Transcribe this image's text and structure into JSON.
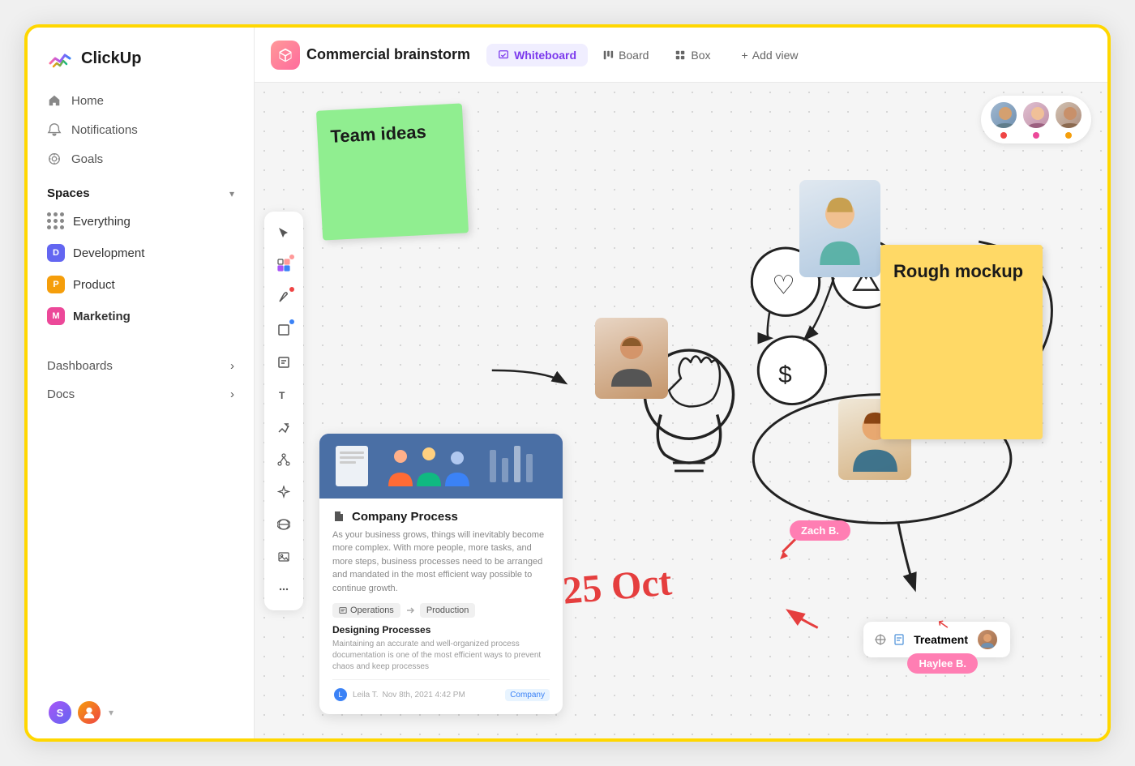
{
  "logo": {
    "text": "ClickUp"
  },
  "sidebar": {
    "nav_items": [
      {
        "id": "home",
        "label": "Home",
        "icon": "🏠"
      },
      {
        "id": "notifications",
        "label": "Notifications",
        "icon": "🔔"
      },
      {
        "id": "goals",
        "label": "Goals",
        "icon": "🏆"
      }
    ],
    "spaces_section": "Spaces",
    "spaces": [
      {
        "id": "everything",
        "label": "Everything",
        "color": "",
        "type": "grid"
      },
      {
        "id": "development",
        "label": "Development",
        "color": "#6366f1",
        "initial": "D"
      },
      {
        "id": "product",
        "label": "Product",
        "color": "#f59e0b",
        "initial": "P"
      },
      {
        "id": "marketing",
        "label": "Marketing",
        "color": "#ec4899",
        "initial": "M",
        "active": true
      }
    ],
    "bottom_items": [
      {
        "id": "dashboards",
        "label": "Dashboards"
      },
      {
        "id": "docs",
        "label": "Docs"
      }
    ]
  },
  "header": {
    "project_title": "Commercial brainstorm",
    "tabs": [
      {
        "id": "whiteboard",
        "label": "Whiteboard",
        "active": true
      },
      {
        "id": "board",
        "label": "Board",
        "active": false
      },
      {
        "id": "box",
        "label": "Box",
        "active": false
      }
    ],
    "add_view_label": "Add view"
  },
  "canvas": {
    "sticky_green_text": "Team ideas",
    "sticky_yellow_text": "Rough mockup",
    "doc_title": "Company Process",
    "doc_desc": "As your business grows, things will inevitably become more complex. With more people, more tasks, and more steps, business processes need to be arranged and mandated in the most efficient way possible to continue growth.",
    "doc_tags": [
      "Operations",
      "Production"
    ],
    "doc_section_title": "Designing Processes",
    "doc_section_desc": "Maintaining an accurate and well-organized process documentation is one of the most efficient ways to prevent chaos and keep processes",
    "doc_author": "Leila T.",
    "doc_date": "Nov 8th, 2021 4:42 PM",
    "doc_badge": "Company",
    "treatment_label": "Treatment",
    "name_tag_zach": "Zach B.",
    "name_tag_haylee": "Haylee B.",
    "oct_text": "25 Oct",
    "people_icon_text": "👥"
  },
  "toolbar": {
    "buttons": [
      {
        "id": "cursor",
        "icon": "↗"
      },
      {
        "id": "palette",
        "icon": "🎨",
        "dot_color": "#ff9999"
      },
      {
        "id": "pen",
        "icon": "✏️"
      },
      {
        "id": "shape",
        "icon": "⬜"
      },
      {
        "id": "note",
        "icon": "📝"
      },
      {
        "id": "text",
        "icon": "T"
      },
      {
        "id": "connector",
        "icon": "⚡"
      },
      {
        "id": "share",
        "icon": "⬡"
      },
      {
        "id": "sparkle",
        "icon": "✨"
      },
      {
        "id": "globe",
        "icon": "🌐"
      },
      {
        "id": "image",
        "icon": "🖼"
      },
      {
        "id": "more",
        "icon": "•••"
      }
    ]
  },
  "collaborators": [
    {
      "id": "user1",
      "dot_color": "#ef4444"
    },
    {
      "id": "user2",
      "dot_color": "#ec4899"
    },
    {
      "id": "user3",
      "dot_color": "#f59e0b"
    }
  ]
}
